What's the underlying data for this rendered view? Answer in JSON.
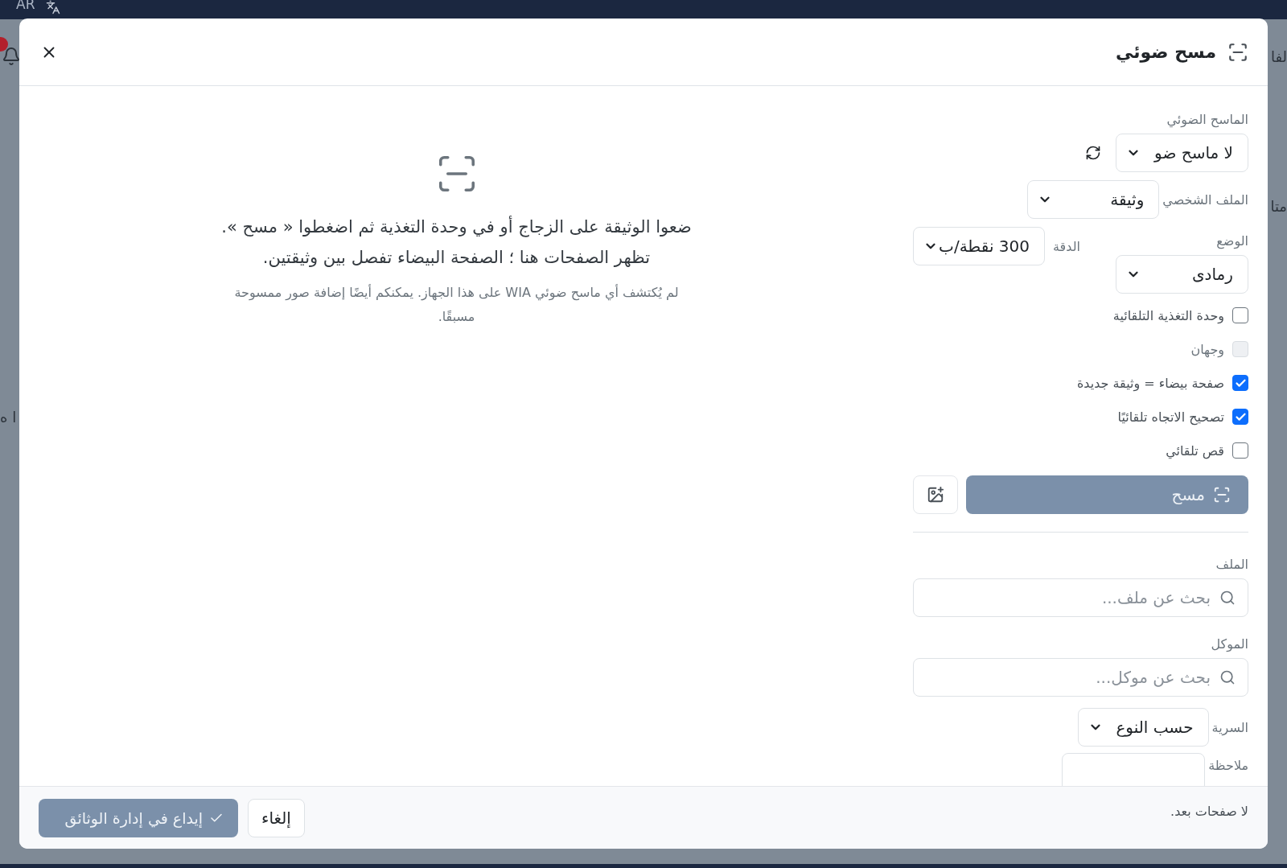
{
  "top_bar": {
    "language": "AR"
  },
  "background_fragments": [
    "لفا",
    "متا",
    "ا ه"
  ],
  "dialog": {
    "title": "مسح ضوئي"
  },
  "scanner": {
    "label": "الماسح الضوئي",
    "value": "لا ماسح ضو"
  },
  "profile": {
    "label": "الملف الشخصي",
    "value": "وثيقة"
  },
  "mode": {
    "label": "الوضع",
    "value": "رمادى"
  },
  "resolution": {
    "label": "الدقة",
    "value": "300 نقطة/ب"
  },
  "options": [
    {
      "label": "وحدة التغذية التلقائية",
      "checked": false,
      "disabled": false
    },
    {
      "label": "وجهان",
      "checked": false,
      "disabled": true
    },
    {
      "label": "صفحة بيضاء = وثيقة جديدة",
      "checked": true,
      "disabled": false
    },
    {
      "label": "تصحيح الاتجاه تلقائيًا",
      "checked": true,
      "disabled": false
    },
    {
      "label": "قص تلقائي",
      "checked": false,
      "disabled": false
    }
  ],
  "scan_button": {
    "label": "مسح",
    "disabled": true
  },
  "file": {
    "label": "الملف",
    "placeholder": "بحث عن ملف..."
  },
  "client": {
    "label": "الموكل",
    "placeholder": "بحث عن موكل..."
  },
  "confidentiality": {
    "label": "السرية",
    "value": "حسب النوع"
  },
  "note": {
    "label": "ملاحظة"
  },
  "preview": {
    "lines": [
      "ضعوا الوثيقة على الزجاج أو في وحدة التغذية ثم اضغطوا « مسح ».",
      "تظهر الصفحات هنا ؛ الصفحة البيضاء تفصل بين وثيقتين."
    ],
    "hint": "لم يُكتشف أي ماسح ضوئي WIA على هذا الجهاز. يمكنكم أيضًا إضافة صور ممسوحة مسبقًا."
  },
  "footer": {
    "status": "لا صفحات بعد.",
    "cancel": "إلغاء",
    "submit": {
      "label": "إيداع في إدارة الوثائق",
      "disabled": true
    }
  }
}
